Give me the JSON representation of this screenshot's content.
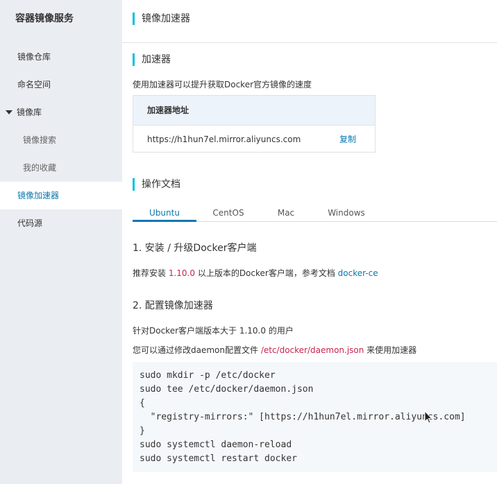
{
  "sidebar": {
    "title": "容器镜像服务",
    "items": [
      {
        "label": "镜像仓库"
      },
      {
        "label": "命名空间"
      },
      {
        "label": "镜像库"
      },
      {
        "label": "镜像搜索"
      },
      {
        "label": "我的收藏"
      },
      {
        "label": "镜像加速器"
      },
      {
        "label": "代码源"
      }
    ]
  },
  "header": {
    "title": "镜像加速器"
  },
  "accelerator": {
    "section_title": "加速器",
    "description": "使用加速器可以提升获取Docker官方镜像的速度",
    "table_header": "加速器地址",
    "address": "https://h1hun7el.mirror.aliyuncs.com",
    "copy_label": "复制"
  },
  "docs": {
    "section_title": "操作文档",
    "tabs": [
      {
        "label": "Ubuntu"
      },
      {
        "label": "CentOS"
      },
      {
        "label": "Mac"
      },
      {
        "label": "Windows"
      }
    ],
    "step1": {
      "title": "1. 安装 / 升级Docker客户端",
      "text_before": "推荐安装 ",
      "version": "1.10.0",
      "text_middle": " 以上版本的Docker客户端，参考文档 ",
      "link": "docker-ce"
    },
    "step2": {
      "title": "2. 配置镜像加速器",
      "line1": "针对Docker客户端版本大于 1.10.0 的用户",
      "line2_before": "您可以通过修改daemon配置文件 ",
      "line2_path": "/etc/docker/daemon.json",
      "line2_after": " 来使用加速器"
    },
    "code_lines": [
      "sudo mkdir -p /etc/docker",
      "sudo tee /etc/docker/daemon.json",
      "{",
      "  \"registry-mirrors:\" [https://h1hun7el.mirror.aliyuncs.com]",
      "}",
      "sudo systemctl daemon-reload",
      "sudo systemctl restart docker"
    ]
  },
  "icons": {
    "group_caret": "caret-down-icon",
    "pointer": "mouse-cursor-icon"
  }
}
